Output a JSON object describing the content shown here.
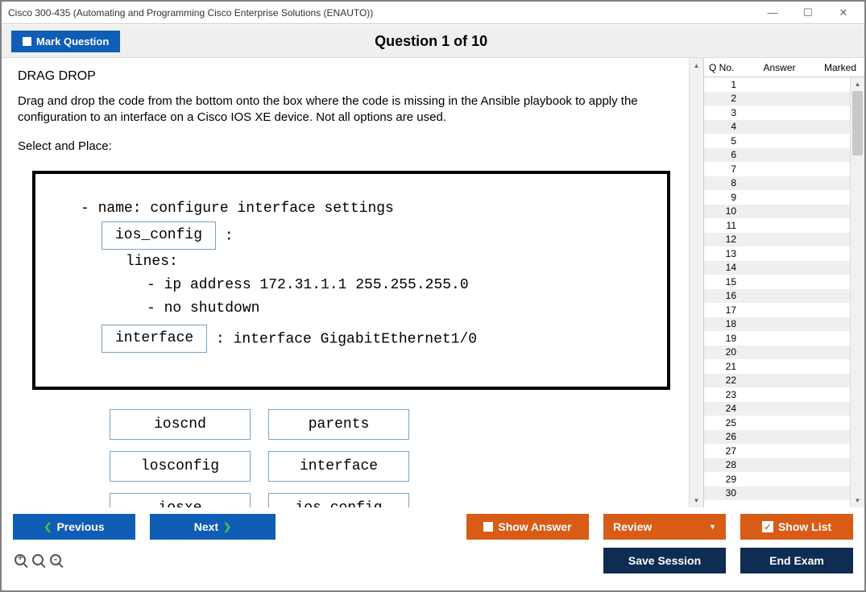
{
  "window": {
    "title": "Cisco 300-435 (Automating and Programming Cisco Enterprise Solutions (ENAUTO))"
  },
  "topbar": {
    "mark_label": "Mark Question",
    "question_heading": "Question 1 of 10"
  },
  "question": {
    "type": "DRAG DROP",
    "instruction": "Drag and drop the code from the bottom onto the box where the code is missing in the Ansible playbook to apply the configuration to an interface on a Cisco IOS XE device. Not all options are used.",
    "select_place": "Select and Place:",
    "code": {
      "line1": "- name: configure interface settings",
      "drop1": "ios_config",
      "after_drop1": ":",
      "lines_label": "lines:",
      "ip_line": "- ip address 172.31.1.1 255.255.255.0",
      "shutdown_line": "- no shutdown",
      "drop2": "interface",
      "after_drop2": ": interface GigabitEthernet1/0"
    },
    "options": {
      "o1": "ioscnd",
      "o2": "parents",
      "o3": "losconfig",
      "o4": "interface",
      "o5": "iosxe",
      "o6": "ios config"
    }
  },
  "sidepanel": {
    "col1": "Q No.",
    "col2": "Answer",
    "col3": "Marked",
    "row_count": 30
  },
  "buttons": {
    "previous": "Previous",
    "next": "Next",
    "show_answer": "Show Answer",
    "review": "Review",
    "show_list": "Show List",
    "save_session": "Save Session",
    "end_exam": "End Exam"
  }
}
